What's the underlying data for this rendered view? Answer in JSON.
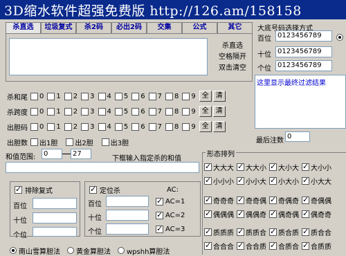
{
  "title": "3D缩水软件超强免费版 http://126.am/158158",
  "tabs": [
    "杀直选",
    "垃圾复式",
    "杀2码",
    "必出2码",
    "交集",
    "公式",
    "其它"
  ],
  "main_side_labels": [
    "杀直选",
    "空格隔开",
    "双击清空"
  ],
  "digits": [
    "0",
    "1",
    "2",
    "3",
    "4",
    "5",
    "6",
    "7",
    "8",
    "9"
  ],
  "rows": [
    {
      "label": "杀和尾",
      "btn_all": "全",
      "btn_clear": "清"
    },
    {
      "label": "杀跨度",
      "btn_all": "全",
      "btn_clear": "清"
    },
    {
      "label": "出胆码",
      "btn_all": "全",
      "btn_clear": "清"
    }
  ],
  "dan_row": {
    "label": "出胆数",
    "options": [
      "出1胆",
      "出2胆",
      "出3胆"
    ]
  },
  "sum_range": {
    "label": "和值范围:",
    "from": "0",
    "to": "27",
    "hint": "下框输入指定杀的和值"
  },
  "exclude_duplex": {
    "label": "排除复式",
    "positions": [
      "百位",
      "十位",
      "个位"
    ]
  },
  "locate_kill": {
    "label": "定位杀",
    "positions": [
      "百位",
      "十位",
      "个位"
    ],
    "ac_title": "AC:",
    "ac_options": [
      "AC=1",
      "AC=2",
      "AC=3"
    ]
  },
  "bottom_radios": [
    "南山雪算胆法",
    "黄金算胆法",
    "wpshh算胆法"
  ],
  "right_panel": {
    "title": "大底号码选择方式",
    "positions": [
      {
        "label": "百位",
        "value": "0123456789"
      },
      {
        "label": "十位",
        "value": "0123456789"
      },
      {
        "label": "个位",
        "value": "0123456789"
      }
    ],
    "result_text": "这里显示最终过滤结果",
    "final_count_label": "最后注数",
    "final_count_value": "0"
  },
  "shape": {
    "title": "形态排列",
    "rows": [
      [
        "大大大",
        "大大小",
        "大小大",
        "大小小"
      ],
      [
        "小小小",
        "小小大",
        "小大小",
        "小大大"
      ],
      [
        "奇奇奇",
        "奇奇偶",
        "奇偶奇",
        "奇偶偶"
      ],
      [
        "偶偶偶",
        "偶偶奇",
        "偶奇偶",
        "偶奇奇"
      ],
      [
        "质质质",
        "质质合",
        "质合质",
        "质合合"
      ],
      [
        "合合合",
        "合合质",
        "合质合",
        "合质质"
      ]
    ]
  }
}
